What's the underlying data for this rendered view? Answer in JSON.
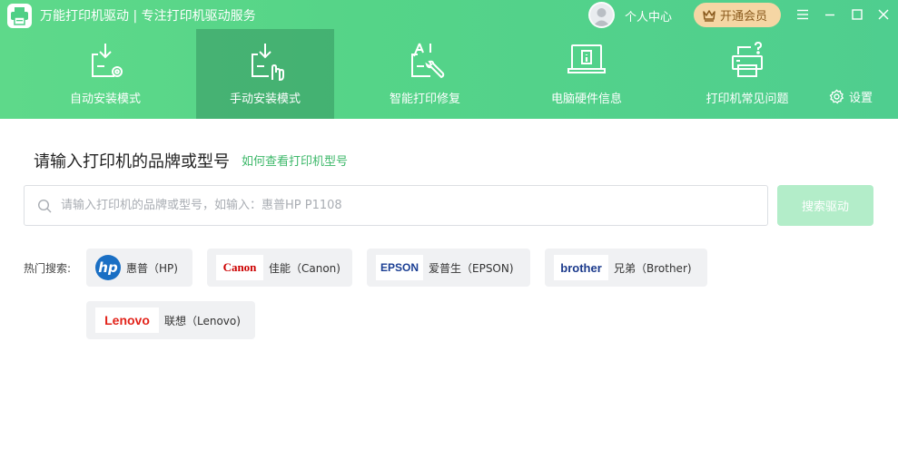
{
  "app": {
    "title": "万能打印机驱动 | 专注打印机驱动服务",
    "user_center": "个人中心",
    "vip_label": "开通会员"
  },
  "nav": {
    "tabs": [
      {
        "label": "自动安装模式",
        "icon": "auto-install-icon"
      },
      {
        "label": "手动安装模式",
        "icon": "manual-install-icon",
        "active": true
      },
      {
        "label": "智能打印修复",
        "icon": "smart-repair-icon"
      },
      {
        "label": "电脑硬件信息",
        "icon": "hardware-info-icon"
      },
      {
        "label": "打印机常见问题",
        "icon": "printer-faq-icon"
      }
    ],
    "settings_label": "设置"
  },
  "search": {
    "title": "请输入打印机的品牌或型号",
    "help_link": "如何查看打印机型号",
    "placeholder": "请输入打印机的品牌或型号，如输入：惠普HP P1108",
    "value": "",
    "button_label": "搜索驱动"
  },
  "hot": {
    "label": "热门搜索:",
    "brands": [
      {
        "logo": "hp",
        "label": "惠普（HP)"
      },
      {
        "logo": "Canon",
        "label": "佳能（Canon)"
      },
      {
        "logo": "EPSON",
        "label": "爱普生（EPSON)"
      },
      {
        "logo": "brother",
        "label": "兄弟（Brother)"
      },
      {
        "logo": "Lenovo",
        "label": "联想（Lenovo)"
      }
    ]
  },
  "colors": {
    "header_green": "#55d488",
    "accent_green": "#3db86a",
    "vip_gold": "#f5d6a4",
    "search_button_disabled": "#b3edc9"
  }
}
